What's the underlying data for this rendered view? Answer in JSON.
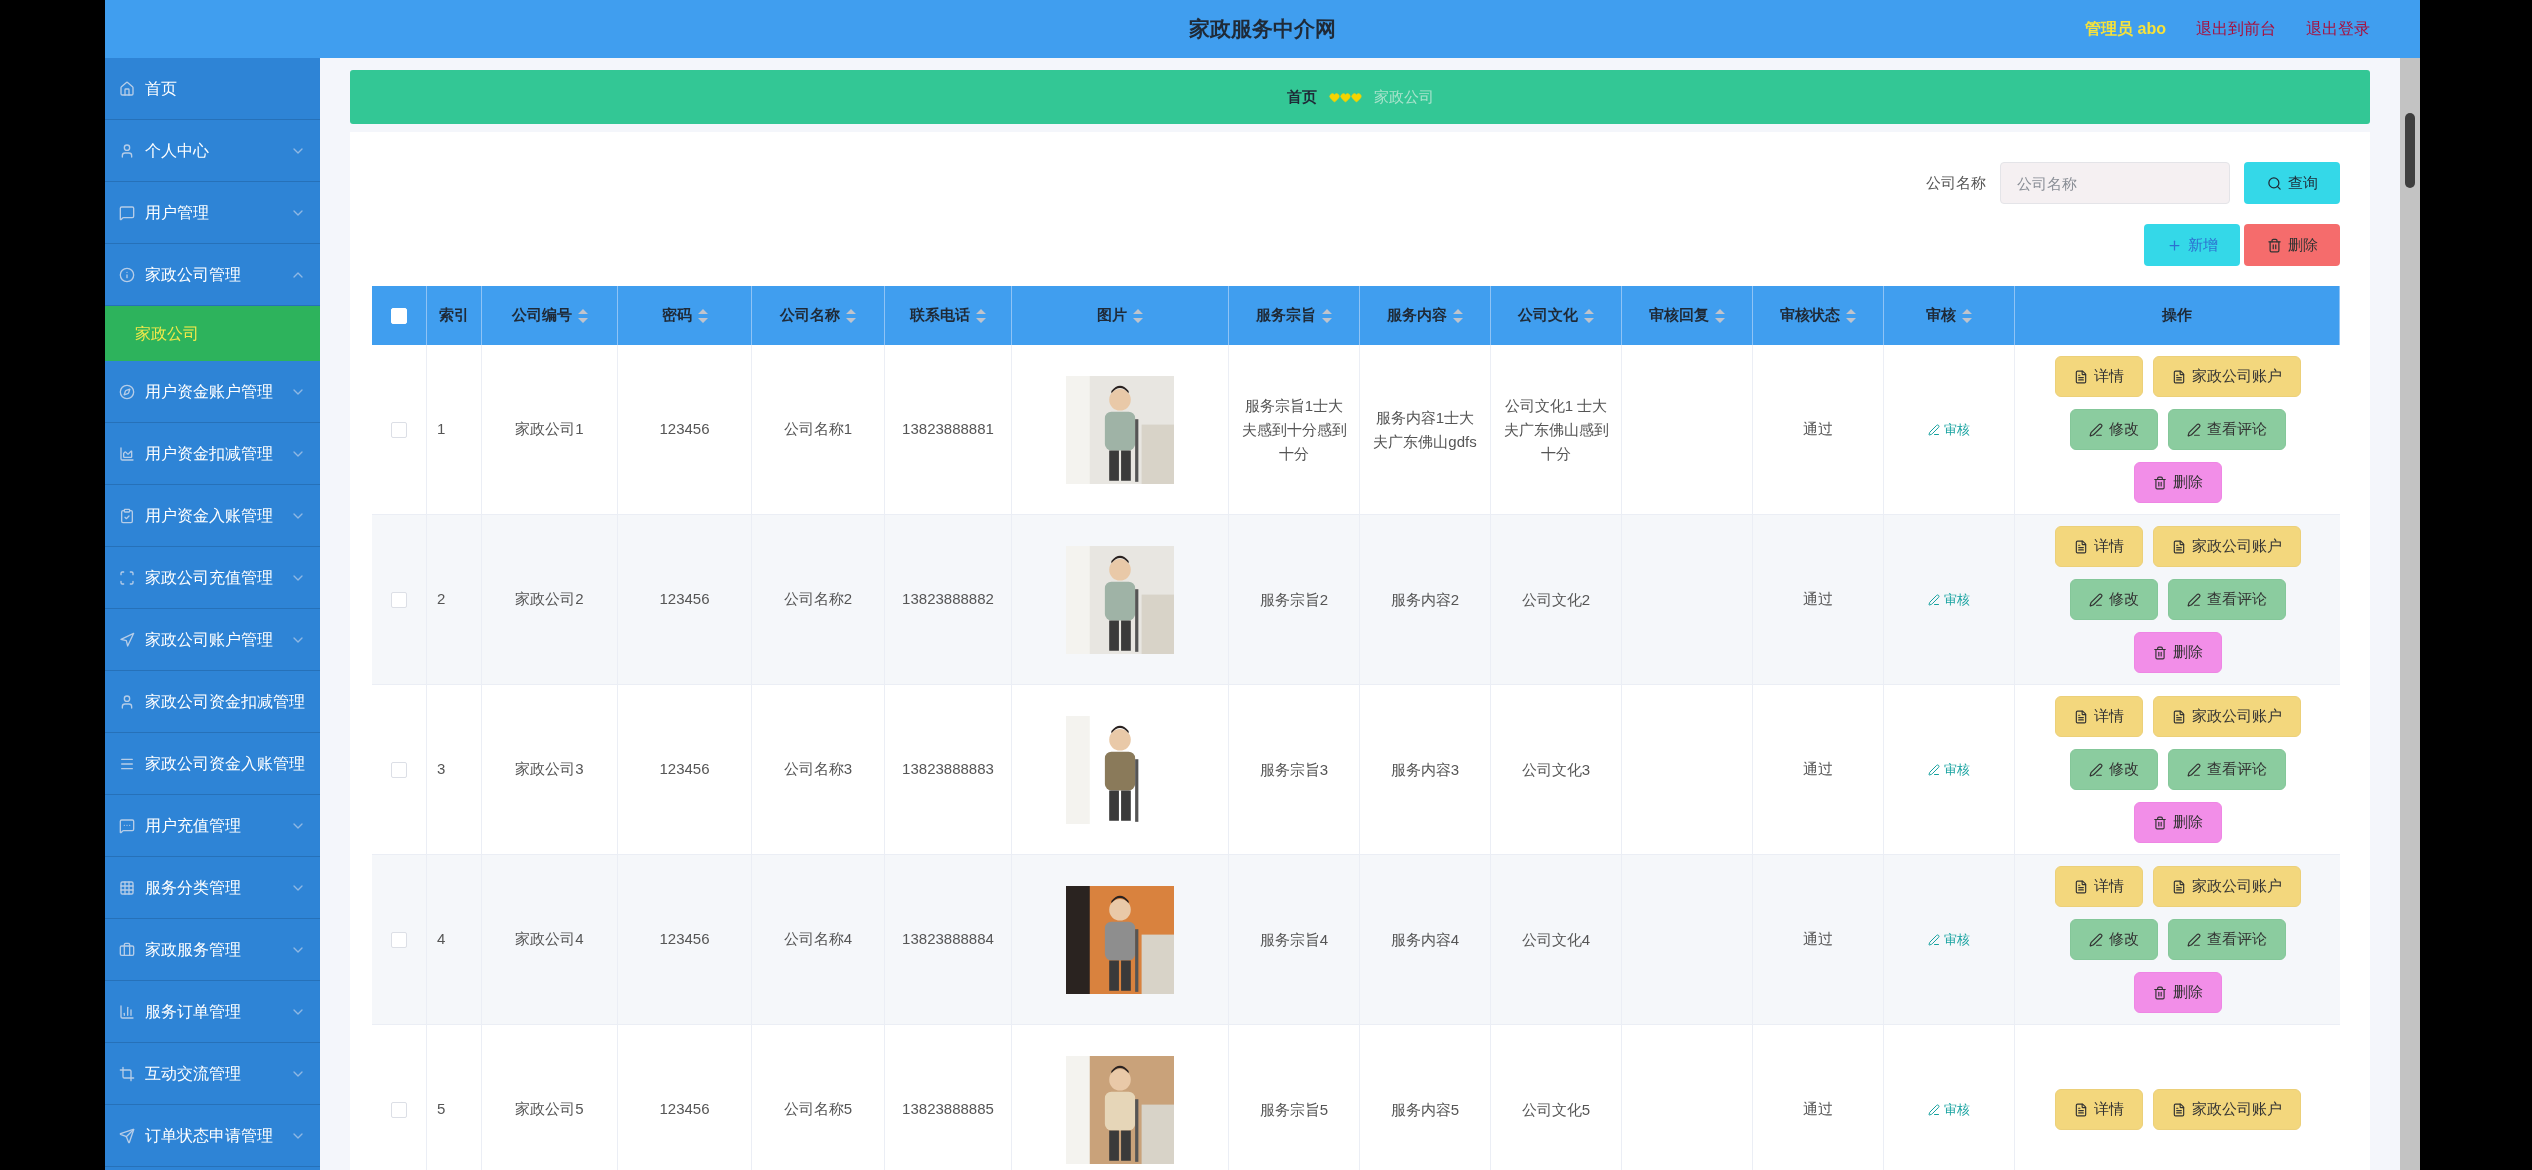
{
  "header": {
    "title": "家政服务中介网",
    "user": "管理员 abo",
    "links": [
      "退出到前台",
      "退出登录"
    ]
  },
  "sidebar": {
    "items": [
      {
        "label": "首页",
        "kind": "link"
      },
      {
        "label": "个人中心",
        "kind": "menu",
        "expanded": false
      },
      {
        "label": "用户管理",
        "kind": "menu",
        "expanded": false
      },
      {
        "label": "家政公司管理",
        "kind": "menu",
        "expanded": true,
        "children": [
          {
            "label": "家政公司",
            "selected": true
          }
        ]
      },
      {
        "label": "用户资金账户管理",
        "kind": "menu",
        "expanded": false
      },
      {
        "label": "用户资金扣减管理",
        "kind": "menu",
        "expanded": false
      },
      {
        "label": "用户资金入账管理",
        "kind": "menu",
        "expanded": false
      },
      {
        "label": "家政公司充值管理",
        "kind": "menu",
        "expanded": false
      },
      {
        "label": "家政公司账户管理",
        "kind": "menu",
        "expanded": false
      },
      {
        "label": "家政公司资金扣减管理",
        "kind": "link"
      },
      {
        "label": "家政公司资金入账管理",
        "kind": "link"
      },
      {
        "label": "用户充值管理",
        "kind": "menu",
        "expanded": false
      },
      {
        "label": "服务分类管理",
        "kind": "menu",
        "expanded": false
      },
      {
        "label": "家政服务管理",
        "kind": "menu",
        "expanded": false
      },
      {
        "label": "服务订单管理",
        "kind": "menu",
        "expanded": false
      },
      {
        "label": "互动交流管理",
        "kind": "menu",
        "expanded": false
      },
      {
        "label": "订单状态申请管理",
        "kind": "menu",
        "expanded": false
      }
    ]
  },
  "breadcrumb": [
    "首页",
    "家政公司"
  ],
  "search": {
    "label": "公司名称",
    "placeholder": "公司名称",
    "button": "查询"
  },
  "toolbar": [
    {
      "label": "新增",
      "kind": "add"
    },
    {
      "label": "删除",
      "kind": "delete"
    }
  ],
  "table": {
    "all_checked": false,
    "columns": [
      {
        "label": "索引",
        "sortable": false
      },
      {
        "label": "公司编号",
        "sortable": true
      },
      {
        "label": "密码",
        "sortable": true
      },
      {
        "label": "公司名称",
        "sortable": true
      },
      {
        "label": "联系电话",
        "sortable": true
      },
      {
        "label": "图片",
        "sortable": true
      },
      {
        "label": "服务宗旨",
        "sortable": true
      },
      {
        "label": "服务内容",
        "sortable": true
      },
      {
        "label": "公司文化",
        "sortable": true
      },
      {
        "label": "审核回复",
        "sortable": true
      },
      {
        "label": "审核状态",
        "sortable": true
      },
      {
        "label": "审核",
        "sortable": true
      },
      {
        "label": "操作",
        "sortable": false
      }
    ],
    "rows": [
      {
        "checked": false,
        "cells": [
          "1",
          "家政公司1",
          "123456",
          "公司名称1",
          "13823888881"
        ],
        "picture": {
          "kind": "picture"
        },
        "texts": [
          "服务宗旨1士大夫感到十分感到十分",
          "服务内容1士大夫广东佛山gdfs",
          "公司文化1 士大夫广东佛山感到十分"
        ],
        "status": "通过",
        "review": "审核",
        "actions": [
          {
            "label": "详情",
            "kind": "detail"
          },
          {
            "label": "家政公司账户",
            "kind": "detail"
          },
          {
            "label": "修改",
            "kind": "edit"
          },
          {
            "label": "查看评论",
            "kind": "edit"
          },
          {
            "label": "删除",
            "kind": "delete"
          }
        ]
      },
      {
        "checked": false,
        "cells": [
          "2",
          "家政公司2",
          "123456",
          "公司名称2",
          "13823888882"
        ],
        "picture": {
          "kind": "picture"
        },
        "texts": [
          "服务宗旨2",
          "服务内容2",
          "公司文化2"
        ],
        "status": "通过",
        "review": "审核",
        "actions": [
          {
            "label": "详情",
            "kind": "detail"
          },
          {
            "label": "家政公司账户",
            "kind": "detail"
          },
          {
            "label": "修改",
            "kind": "edit"
          },
          {
            "label": "查看评论",
            "kind": "edit"
          },
          {
            "label": "删除",
            "kind": "delete"
          }
        ]
      },
      {
        "checked": false,
        "cells": [
          "3",
          "家政公司3",
          "123456",
          "公司名称3",
          "13823888883"
        ],
        "picture": {
          "kind": "picture"
        },
        "texts": [
          "服务宗旨3",
          "服务内容3",
          "公司文化3"
        ],
        "status": "通过",
        "review": "审核",
        "actions": [
          {
            "label": "详情",
            "kind": "detail"
          },
          {
            "label": "家政公司账户",
            "kind": "detail"
          },
          {
            "label": "修改",
            "kind": "edit"
          },
          {
            "label": "查看评论",
            "kind": "edit"
          },
          {
            "label": "删除",
            "kind": "delete"
          }
        ]
      },
      {
        "checked": false,
        "cells": [
          "4",
          "家政公司4",
          "123456",
          "公司名称4",
          "13823888884"
        ],
        "picture": {
          "kind": "picture"
        },
        "texts": [
          "服务宗旨4",
          "服务内容4",
          "公司文化4"
        ],
        "status": "通过",
        "review": "审核",
        "actions": [
          {
            "label": "详情",
            "kind": "detail"
          },
          {
            "label": "家政公司账户",
            "kind": "detail"
          },
          {
            "label": "修改",
            "kind": "edit"
          },
          {
            "label": "查看评论",
            "kind": "edit"
          },
          {
            "label": "删除",
            "kind": "delete"
          }
        ]
      },
      {
        "checked": false,
        "cells": [
          "5",
          "家政公司5",
          "123456",
          "公司名称5",
          "13823888885"
        ],
        "picture": {
          "kind": "picture"
        },
        "texts": [
          "服务宗旨5",
          "服务内容5",
          "公司文化5"
        ],
        "status": "通过",
        "review": "审核",
        "actions": [
          {
            "label": "详情",
            "kind": "detail"
          },
          {
            "label": "家政公司账户",
            "kind": "detail"
          }
        ]
      }
    ]
  }
}
